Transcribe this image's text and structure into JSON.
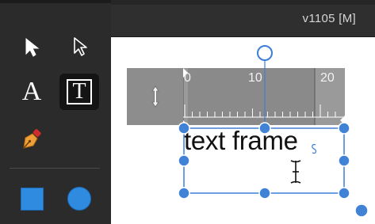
{
  "status": {
    "version_text": "v1105  [M]"
  },
  "toolbar": {
    "tools": [
      {
        "name": "Move Tool",
        "icon": "arrow-filled-icon"
      },
      {
        "name": "Node Tool",
        "icon": "arrow-outline-icon"
      },
      {
        "name": "Artistic Text Tool",
        "icon": "artistic-text-icon",
        "glyph": "A"
      },
      {
        "name": "Frame Text Tool",
        "icon": "frame-text-icon",
        "glyph": "T",
        "selected": true
      },
      {
        "name": "Pen Tool",
        "icon": "pen-nib-icon"
      },
      {
        "name": "Rectangle Tool",
        "icon": "rectangle-icon"
      },
      {
        "name": "Ellipse Tool",
        "icon": "ellipse-icon"
      }
    ]
  },
  "ruler": {
    "labels": [
      "0",
      "10",
      "20"
    ],
    "handle_icon": "vertical-resize-icon"
  },
  "canvas": {
    "frame_text": "text frame"
  },
  "colors": {
    "accent": "#3d7ed8",
    "handle_fill": "#3f82d6",
    "toolbar_bg": "#2b2b2b",
    "selected_tool_bg": "#141414"
  }
}
